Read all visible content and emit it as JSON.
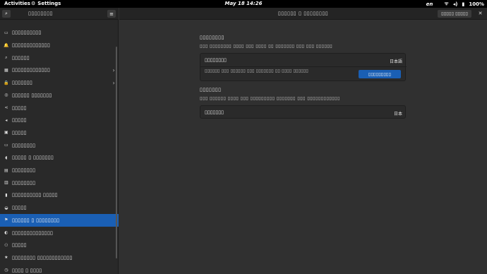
{
  "topbar": {
    "activities": "Activities",
    "app_name": "Settings",
    "clock": "May 18  14:26",
    "lang": "en",
    "battery": "100%"
  },
  "sidebar": {
    "title": "▯▯▯▯▯▯▯▯",
    "items": [
      {
        "label": "▯▯▯▯▯▯▯▯▯▯",
        "icon": "network-icon",
        "glyph": "▭",
        "chevron": ""
      },
      {
        "label": "▯▯▯▯▯▯▯▯▯▯▯▯▯",
        "icon": "notifications-icon",
        "glyph": "🔔",
        "chevron": ""
      },
      {
        "label": "▯▯▯▯▯▯",
        "icon": "search-icon",
        "glyph": "⌕",
        "chevron": ""
      },
      {
        "label": "▯▯▯▯▯▯▯▯▯▯▯▯▯",
        "icon": "apps-icon",
        "glyph": "▦",
        "chevron": "›"
      },
      {
        "label": "▯▯▯▯▯▯▯",
        "icon": "privacy-icon",
        "glyph": "🔒",
        "chevron": "›"
      },
      {
        "label": "▯▯▯▯▯▯ ▯▯▯▯▯▯▯",
        "icon": "online-accounts-icon",
        "glyph": "◎",
        "chevron": ""
      },
      {
        "label": "▯▯▯▯▯",
        "icon": "sharing-icon",
        "glyph": "⋖",
        "chevron": ""
      },
      {
        "label": "▯▯▯▯▯",
        "icon": "sound-icon",
        "glyph": "◂",
        "chevron": ""
      },
      {
        "label": "▯▯▯▯▯",
        "icon": "power-icon",
        "glyph": "▣",
        "chevron": ""
      },
      {
        "label": "▯▯▯▯▯▯▯▯",
        "icon": "displays-icon",
        "glyph": "▭",
        "chevron": ""
      },
      {
        "label": "▯▯▯▯▯ ▯ ▯▯▯▯▯▯▯",
        "icon": "mouse-touchpad-icon",
        "glyph": "◖",
        "chevron": ""
      },
      {
        "label": "▯▯▯▯▯▯▯▯",
        "icon": "keyboard-icon",
        "glyph": "▤",
        "chevron": ""
      },
      {
        "label": "▯▯▯▯▯▯▯▯",
        "icon": "printers-icon",
        "glyph": "▥",
        "chevron": ""
      },
      {
        "label": "▯▯▯▯▯▯▯▯▯▯ ▯▯▯▯▯",
        "icon": "removable-media-icon",
        "glyph": "▮",
        "chevron": ""
      },
      {
        "label": "▯▯▯▯▯",
        "icon": "color-icon",
        "glyph": "◒",
        "chevron": ""
      },
      {
        "label": "▯▯▯▯▯▯ ▯ ▯▯▯▯▯▯▯▯",
        "icon": "region-language-icon",
        "glyph": "⚑",
        "chevron": ""
      },
      {
        "label": "▯▯▯▯▯▯▯▯▯▯▯▯▯▯",
        "icon": "accessibility-icon",
        "glyph": "◐",
        "chevron": ""
      },
      {
        "label": "▯▯▯▯▯",
        "icon": "users-icon",
        "glyph": "⚇",
        "chevron": ""
      },
      {
        "label": "▯▯▯▯▯▯▯▯ ▯▯▯▯▯▯▯▯▯▯▯▯",
        "icon": "default-apps-icon",
        "glyph": "★",
        "chevron": ""
      },
      {
        "label": "▯▯▯▯ ▯ ▯▯▯▯",
        "icon": "date-time-icon",
        "glyph": "◷",
        "chevron": ""
      }
    ],
    "active_index": 15
  },
  "main": {
    "title": "▯▯▯▯▯▯ ▯ ▯▯▯▯▯▯▯▯",
    "login_button": "▯▯▯▯▯ ▯▯▯▯▯",
    "language_section": {
      "title": "▯▯▯▯▯▯▯▯",
      "description": "▯▯▯ ▯▯▯▯▯▯▯▯ ▯▯▯▯ ▯▯▯ ▯▯▯▯ ▯▯ ▯▯▯▯▯▯▯ ▯▯▯ ▯▯▯ ▯▯▯▯▯▯",
      "row_label": "▯▯▯▯▯▯▯▯",
      "row_value": "日本語",
      "restart_text": "▯▯▯▯▯▯ ▯▯▯ ▯▯▯▯▯▯ ▯▯▯ ▯▯▯▯▯▯▯ ▯▯ ▯▯▯▯ ▯▯▯▯▯▯",
      "restart_button": "▯▯▯▯▯▯▯▯▯"
    },
    "formats_section": {
      "title": "▯▯▯▯▯▯▯",
      "description": "▯▯▯ ▯▯▯▯▯▯ ▯▯▯▯ ▯▯▯ ▯▯▯▯▯▯▯▯▯ ▯▯▯▯▯▯▯ ▯▯▯ ▯▯▯▯▯▯▯▯▯▯▯▯",
      "row_label": "▯▯▯▯▯▯▯",
      "row_value": "日本"
    }
  },
  "colors": {
    "accent": "#1a5fb4",
    "window_bg": "#303030",
    "sidebar_bg": "#292929",
    "header_bg": "#242424"
  }
}
